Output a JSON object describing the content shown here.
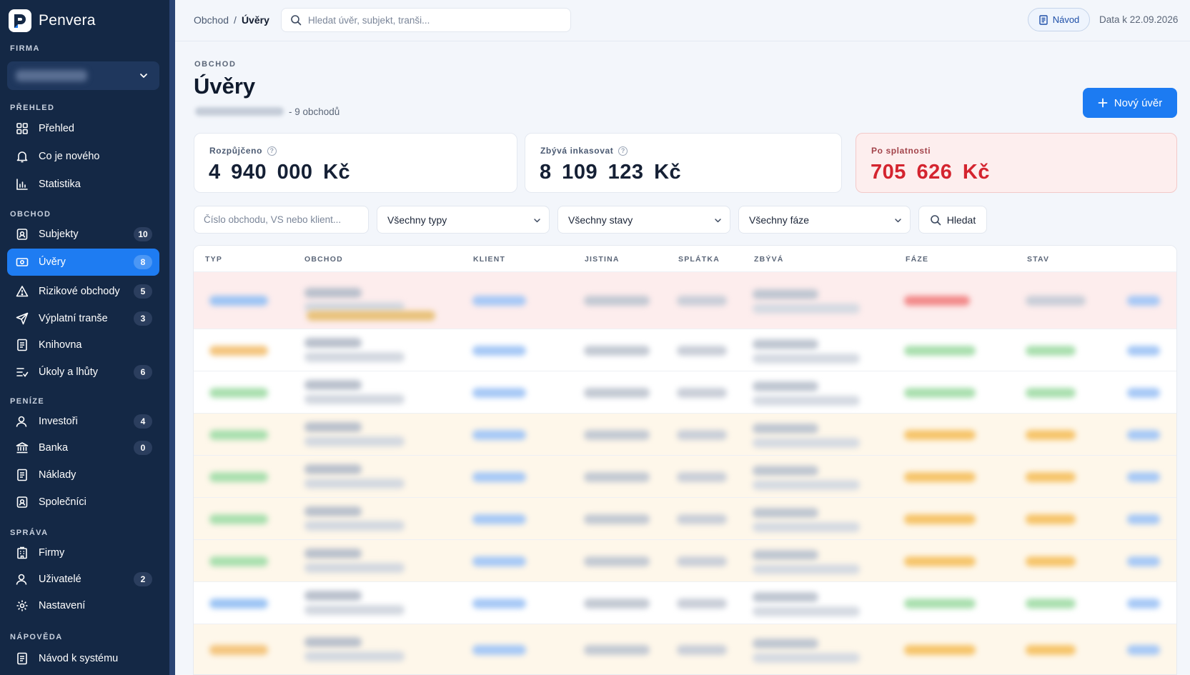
{
  "app": {
    "name": "Penvera"
  },
  "sidebar": {
    "firm_title": "FIRMA",
    "sections": [
      {
        "title": "PŘEHLED",
        "items": [
          {
            "label": "Přehled",
            "icon": "grid-icon"
          },
          {
            "label": "Co je nového",
            "icon": "bell-icon"
          },
          {
            "label": "Statistika",
            "icon": "bar-chart-icon"
          }
        ]
      },
      {
        "title": "OBCHOD",
        "items": [
          {
            "label": "Subjekty",
            "icon": "id-badge-icon",
            "badge": "10"
          },
          {
            "label": "Úvěry",
            "icon": "banknote-icon",
            "badge": "8",
            "active": true
          },
          {
            "label": "Rizikové obchody",
            "icon": "warning-icon",
            "badge": "5"
          },
          {
            "label": "Výplatní tranše",
            "icon": "send-icon",
            "badge": "3"
          },
          {
            "label": "Knihovna",
            "icon": "document-icon"
          },
          {
            "label": "Úkoly a lhůty",
            "icon": "tasks-icon",
            "badge": "6"
          }
        ]
      },
      {
        "title": "PENÍZE",
        "items": [
          {
            "label": "Investoři",
            "icon": "user-icon",
            "badge": "4"
          },
          {
            "label": "Banka",
            "icon": "bank-icon",
            "badge": "0"
          },
          {
            "label": "Náklady",
            "icon": "receipt-icon"
          },
          {
            "label": "Společníci",
            "icon": "id-badge-icon"
          }
        ]
      },
      {
        "title": "SPRÁVA",
        "items": [
          {
            "label": "Firmy",
            "icon": "building-icon"
          },
          {
            "label": "Uživatelé",
            "icon": "user-icon",
            "badge": "2"
          },
          {
            "label": "Nastavení",
            "icon": "gear-icon"
          }
        ]
      },
      {
        "title": "NÁPOVĚDA",
        "items": [
          {
            "label": "Návod k systému",
            "icon": "document-icon"
          }
        ]
      }
    ]
  },
  "topbar": {
    "breadcrumb": [
      "Obchod",
      "/",
      "Úvěry"
    ],
    "search_placeholder": "Hledat úvěr, subjekt, tranši...",
    "guide_label": "Návod",
    "data_date": "Data k 22.09.2026"
  },
  "page": {
    "eyebrow": "OBCHOD",
    "title": "Úvěry",
    "subtitle_count": "- 9 obchodů",
    "new_button": "Nový úvěr"
  },
  "stats": [
    {
      "label": "Rozpůjčeno",
      "value": "4 940 000 Kč",
      "help": true
    },
    {
      "label": "Zbývá inkasovat",
      "value": "8 109 123 Kč",
      "help": true
    },
    {
      "label": "Po splatnosti",
      "value": "705 626 Kč",
      "help": false
    }
  ],
  "filters": {
    "search_placeholder": "Číslo obchodu, VS nebo klient...",
    "type": "Všechny typy",
    "status": "Všechny stavy",
    "phase": "Všechny fáze",
    "find_label": "Hledat"
  },
  "table": {
    "columns": [
      "TYP",
      "OBCHOD",
      "KLIENT",
      "JISTINA",
      "SPLÁTKA",
      "ZBÝVÁ",
      "FÁZE",
      "STAV"
    ]
  },
  "colors": {
    "sidebar_bg": "#142845",
    "accent": "#1c7bf2",
    "danger": "#d4242f",
    "row_overdue": "#fdeded",
    "row_warning": "#fef7ea"
  }
}
